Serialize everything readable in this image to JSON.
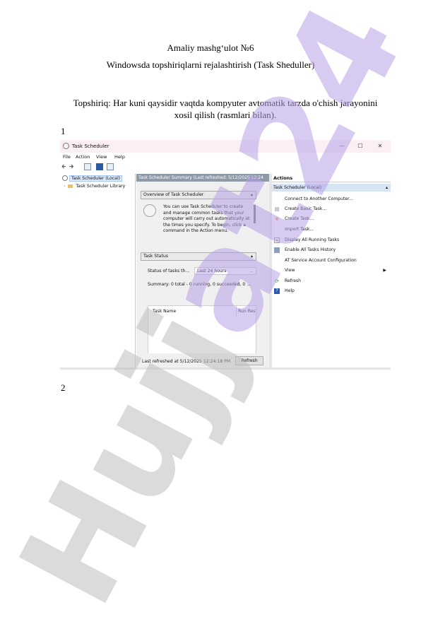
{
  "document": {
    "title": "Amaliy mashg‘ulot №6",
    "subtitle": "Windowsda topshiriqlarni rejalashtirish (Task Sheduller)",
    "task_line1": "Topshiriq: Har kuni qaysidir vaqtda kompyuter avtomatik tarzda o'chish jarayonini",
    "task_line2": "xosil qilish (rasmlari bilan).",
    "fig1_number": "1",
    "fig2_number": "2"
  },
  "screenshot": {
    "window_title": "Task Scheduler",
    "window_controls": {
      "minimize": "—",
      "maximize": "☐",
      "close": "✕"
    },
    "menu": [
      "File",
      "Action",
      "View",
      "Help"
    ],
    "toolbar": {
      "back": "🡰",
      "forward": "🡲"
    },
    "tree": {
      "root": "Task Scheduler (Local)",
      "child": "Task Scheduler Library"
    },
    "center": {
      "header": "Task Scheduler Summary (Last refreshed: 5/12/2025 12:24",
      "overview_title": "Overview of Task Scheduler",
      "overview_text": "You can use Task Scheduler to create and manage common tasks that your computer will carry out automatically at the times you specify. To begin, click a command in the Action menu.",
      "status_title": "Task Status",
      "status_label": "Status of tasks th...",
      "status_value": "Last 24 hours",
      "summary": "Summary: 0 total - 0 running, 0 succeeded, 0 ...",
      "table_col1": "Task Name",
      "table_col2": "Run Res",
      "last_refreshed": "Last refreshed at 5/12/2025 12:24:18 PM",
      "refresh_button": "Refresh"
    },
    "actions": {
      "header": "Actions",
      "subheader": "Task Scheduler (Local)",
      "items": [
        "Connect to Another Computer...",
        "Create Basic Task...",
        "Create Task...",
        "Import Task...",
        "Display All Running Tasks",
        "Enable All Tasks History",
        "AT Service Account Configuration",
        "View",
        "Refresh",
        "Help"
      ]
    }
  },
  "watermark": {
    "text_gray": "Hujj",
    "text_purple": "at24"
  }
}
